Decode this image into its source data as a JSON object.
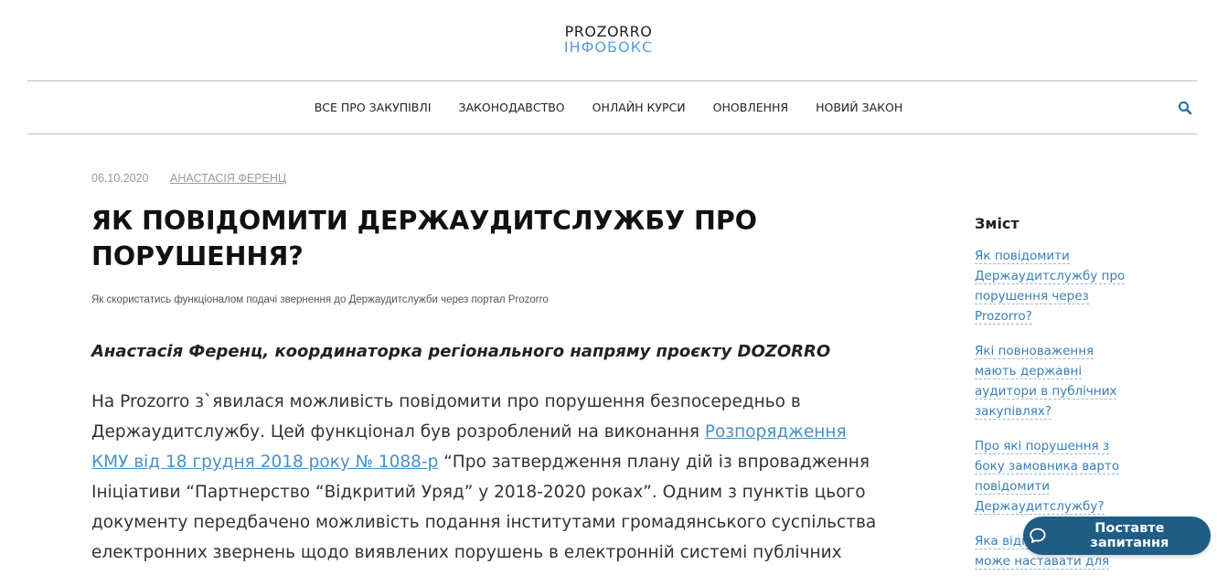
{
  "logo": {
    "line1": "PROZORRO",
    "line2": "ІНФОБОКС"
  },
  "nav": {
    "items": [
      {
        "label": "ВСЕ ПРО ЗАКУПІВЛІ"
      },
      {
        "label": "ЗАКОНОДАВСТВО"
      },
      {
        "label": "ОНЛАЙН КУРСИ"
      },
      {
        "label": "ОНОВЛЕННЯ"
      },
      {
        "label": "НОВИЙ ЗАКОН"
      }
    ],
    "search_icon": "search-icon"
  },
  "article": {
    "date": "06.10.2020",
    "author": "АНАСТАСІЯ ФЕРЕНЦ",
    "title": "ЯК ПОВІДОМИТИ ДЕРЖАУДИТСЛУЖБУ ПРО ПОРУШЕННЯ?",
    "subtitle": "Як скористатись функціоналом подачі звернення до Держаудитслужби через портал Prozorro",
    "lead": "Анастасія Ференц, координаторка регіонального напряму проєкту DOZORRO",
    "body": {
      "p1_before": "На Prozorro з`явилася можливість повідомити про порушення безпосередньо в Держаудитслужбу. Цей функціонал був розроблений на виконання ",
      "p1_link": "Розпорядження КМУ від 18 грудня 2018 року № 1088-р",
      "p1_after": " “Про затвердження плану дій із впровадження Ініціативи “Партнерство “Відкритий Уряд” у 2018-2020 роках”. Одним з пунктів цього документу передбачено можливість подання інститутами громадянського суспільства електронних звернень щодо виявлених порушень в електронній системі публічних"
    }
  },
  "toc": {
    "title": "Зміст",
    "items": [
      "Як повідомити Держаудитслужбу про порушення через Prozorro?",
      "Які повноваження мають державні аудитори в публічних закупівлях?",
      "Про які порушення з боку замовника варто повідомити Держаудитслужбу?",
      "Яка відповідальність може наставати для"
    ]
  },
  "chat": {
    "label": "Поставте запитання",
    "icon": "chat-bubble-icon"
  },
  "colors": {
    "accent": "#4a90c2",
    "chat_button": "#1f5d85",
    "logo_sub": "#5b9bd5"
  }
}
